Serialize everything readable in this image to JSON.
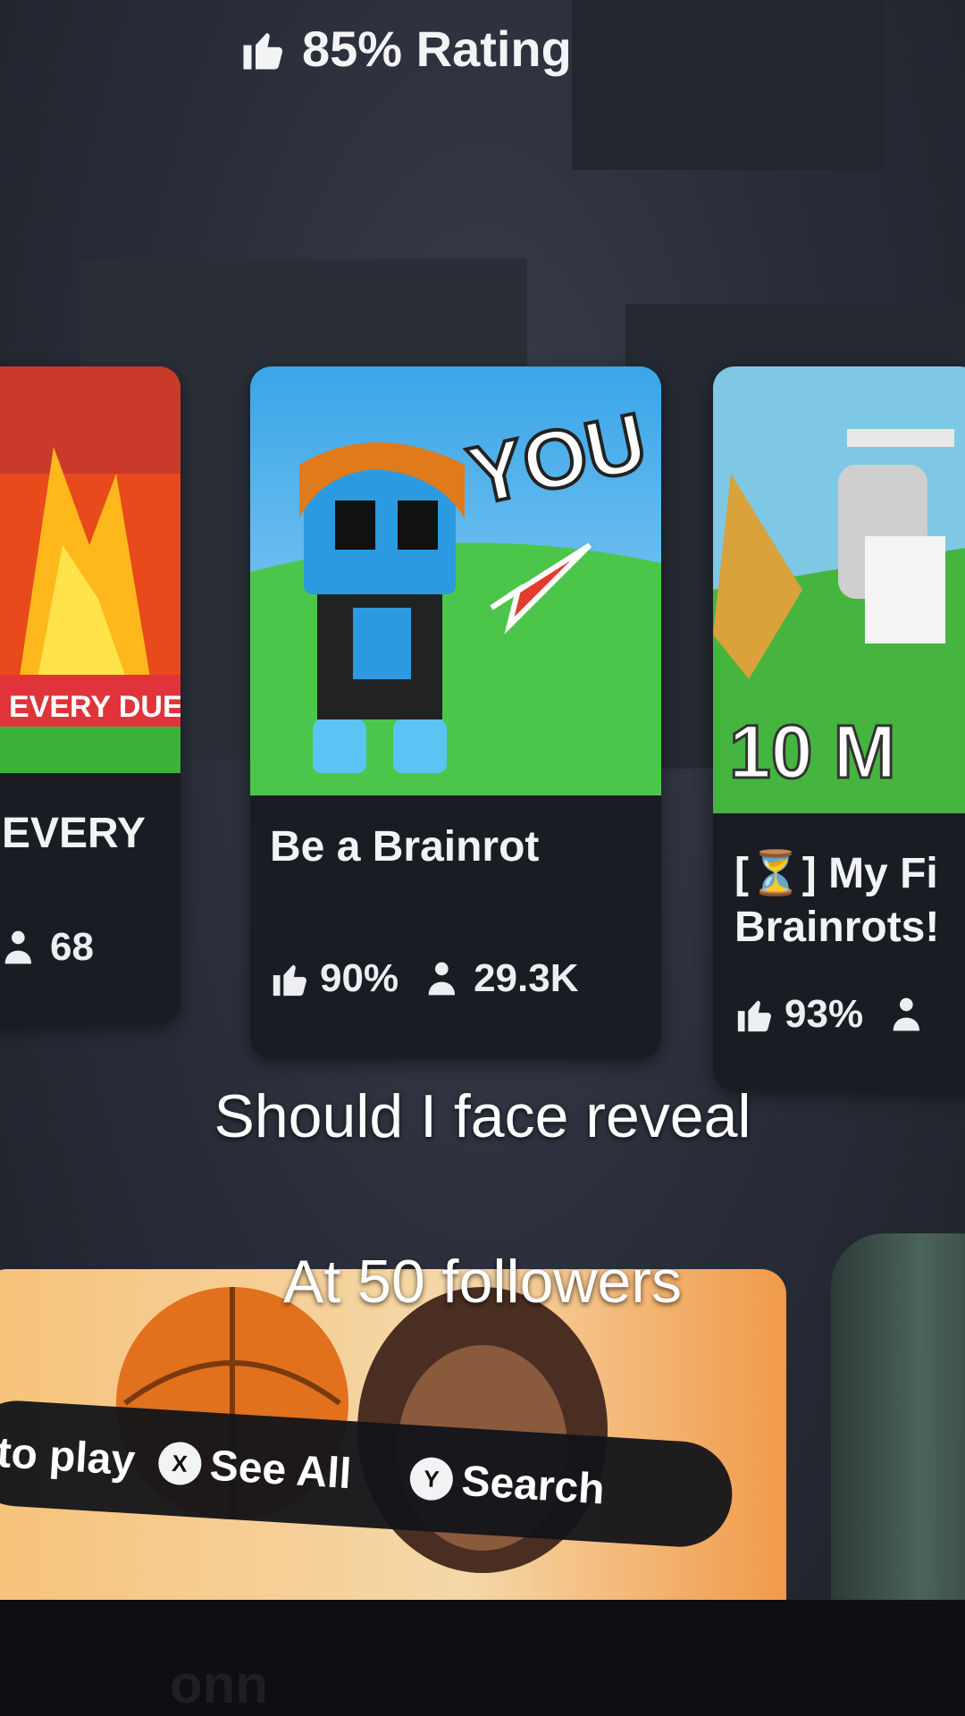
{
  "top_rating": {
    "icon": "thumbs-up-icon",
    "text": "85% Rating"
  },
  "cards": {
    "left": {
      "thumb_text": "EVERY DUEL!",
      "title": "EVERY",
      "players": "68",
      "players_icon": "players-icon"
    },
    "mid": {
      "thumb_text": "YOU",
      "title": "Be a Brainrot",
      "rating": "90%",
      "players": "29.3K",
      "rating_icon": "thumbs-up-icon",
      "players_icon": "players-icon"
    },
    "right": {
      "thumb_text": "10 M",
      "title_line1": "[⏳] My Fi",
      "title_line2": "Brainrots!",
      "rating": "93%",
      "rating_icon": "thumbs-up-icon",
      "players_icon": "players-icon"
    }
  },
  "caption": {
    "line1": "Should I face reveal",
    "line2": "At 50 followers"
  },
  "hints": {
    "play": "to play",
    "see_all_button": "X",
    "see_all": "See All",
    "search_button": "Y",
    "search": "Search"
  },
  "device_brand": "onn"
}
